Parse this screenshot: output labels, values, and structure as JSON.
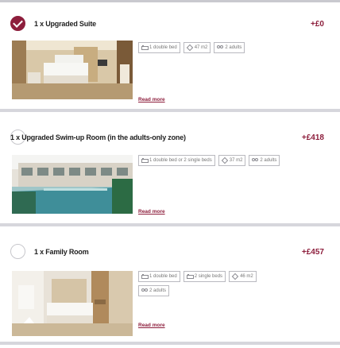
{
  "rooms": [
    {
      "name": "1 x Upgraded Suite",
      "price": "+£0",
      "selected": true,
      "chips": [
        {
          "icon": "bed-icon",
          "label": "1 double bed"
        },
        {
          "icon": "area-icon",
          "label": "47 m2"
        },
        {
          "icon": "people-icon",
          "label": "2 adults"
        }
      ],
      "read_more": "Read more"
    },
    {
      "name": "1 x Upgraded Swim-up Room (in the adults-only zone)",
      "price": "+£418",
      "selected": false,
      "chips": [
        {
          "icon": "bed-icon",
          "label": "1 double bed or 2 single beds"
        },
        {
          "icon": "area-icon",
          "label": "37 m2"
        },
        {
          "icon": "people-icon",
          "label": "2 adults"
        }
      ],
      "read_more": "Read more"
    },
    {
      "name": "1 x Family Room",
      "price": "+£457",
      "selected": false,
      "chips": [
        {
          "icon": "bed-icon",
          "label": "1 double bed"
        },
        {
          "icon": "bed-icon",
          "label": "2 single beds"
        },
        {
          "icon": "area-icon",
          "label": "46 m2"
        },
        {
          "icon": "people-icon",
          "label": "2 adults"
        }
      ],
      "read_more": "Read more"
    }
  ],
  "colors": {
    "accent": "#8d1e3c",
    "border": "#b9b9bf",
    "separator": "#d6d6dc"
  }
}
